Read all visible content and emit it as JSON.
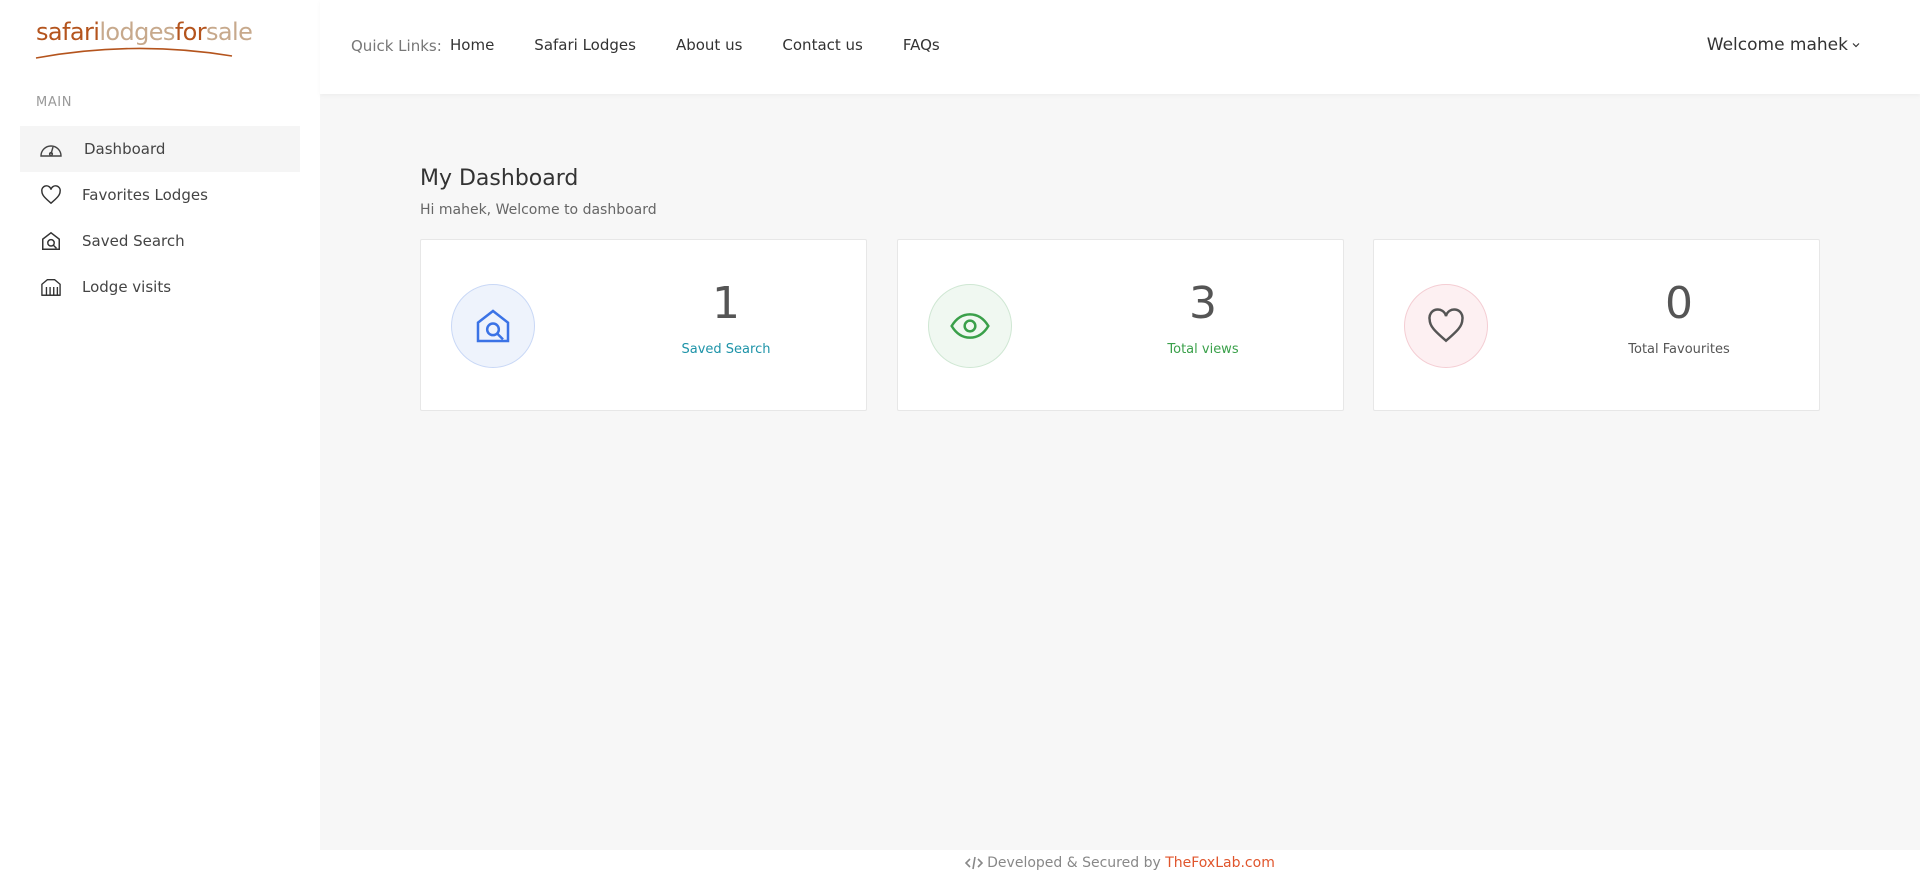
{
  "logo": {
    "part1": "safari",
    "part2": "lodges",
    "part3": "for",
    "part4": "sale"
  },
  "sidebar": {
    "section_label": "MAIN",
    "items": [
      {
        "label": "Dashboard",
        "icon": "dashboard-gauge-icon"
      },
      {
        "label": "Favorites Lodges",
        "icon": "heart-icon"
      },
      {
        "label": "Saved Search",
        "icon": "home-search-icon"
      },
      {
        "label": "Lodge visits",
        "icon": "buildings-icon"
      }
    ]
  },
  "header": {
    "quick_links_label": "Quick Links:",
    "links": [
      "Home",
      "Safari Lodges",
      "About us",
      "Contact us",
      "FAQs"
    ],
    "welcome": "Welcome mahek"
  },
  "main": {
    "title": "My Dashboard",
    "subtitle": "Hi mahek, Welcome to dashboard",
    "cards": [
      {
        "count": "1",
        "label": "Saved Search",
        "icon": "home-search-icon",
        "color": "#1d93a8"
      },
      {
        "count": "3",
        "label": "Total views",
        "icon": "eye-icon",
        "color": "#3aa04a"
      },
      {
        "count": "0",
        "label": "Total Favourites",
        "icon": "heart-icon",
        "color": "#555555"
      }
    ]
  },
  "footer": {
    "text": "Developed & Secured by",
    "brand": "TheFoxLab.com"
  },
  "colors": {
    "accent_orange": "#e0552c",
    "logo_brown": "#b4541d",
    "search_blue": "#3b73e6",
    "views_green": "#3aa04a"
  }
}
